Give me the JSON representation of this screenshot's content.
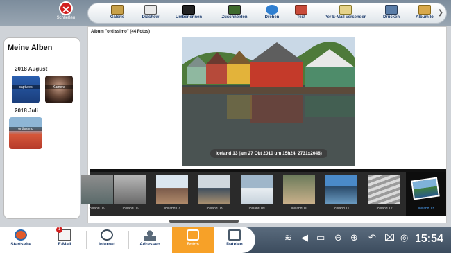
{
  "close": {
    "label": "Schließen"
  },
  "toolbar": [
    {
      "label": "Galerie",
      "icon": "gallery-icon"
    },
    {
      "label": "Diashow",
      "icon": "slideshow-icon"
    },
    {
      "label": "Umbenennen",
      "icon": "rename-icon"
    },
    {
      "label": "Zuschneiden",
      "icon": "crop-icon"
    },
    {
      "label": "Drehen",
      "icon": "rotate-icon"
    },
    {
      "label": "Text",
      "icon": "text-icon"
    },
    {
      "label": "Per E-Mail versenden",
      "icon": "email-send-icon"
    },
    {
      "label": "Drucken",
      "icon": "print-icon"
    },
    {
      "label": "Album lö",
      "icon": "album-delete-icon"
    }
  ],
  "sidebar": {
    "title": "Meine Alben",
    "groups": [
      {
        "label": "2018 August",
        "albums": [
          {
            "label": "captures"
          },
          {
            "label": "Kamera"
          }
        ]
      },
      {
        "label": "2018 Juli",
        "albums": [
          {
            "label": "ordissimo"
          }
        ]
      }
    ]
  },
  "main": {
    "album_title": "Album \"ordissimo\" (44 Fotos)",
    "photo_caption": "Iceland 13 (am 27 Okt 2010 um 15h24, 2731x2048)"
  },
  "strip": [
    {
      "label": "Iceland 05"
    },
    {
      "label": "Iceland 06"
    },
    {
      "label": "Iceland 07"
    },
    {
      "label": "Iceland 08"
    },
    {
      "label": "Iceland 09"
    },
    {
      "label": "Iceland 10"
    },
    {
      "label": "Iceland 11"
    },
    {
      "label": "Iceland 12"
    },
    {
      "label": "Iceland 13"
    }
  ],
  "dock": [
    {
      "label": "Startseite",
      "icon": "home-icon"
    },
    {
      "label": "E-Mail",
      "icon": "email-icon",
      "badge": "1"
    },
    {
      "label": "Internet",
      "icon": "globe-icon"
    },
    {
      "label": "Adressen",
      "icon": "contacts-icon"
    },
    {
      "label": "Fotos",
      "icon": "camera-icon"
    },
    {
      "label": "Dateien",
      "icon": "files-icon"
    }
  ],
  "system": {
    "clock": "15:54"
  },
  "colors": {
    "accent": "#f7a128",
    "close": "#d21f1f",
    "label_blue": "#1d3c6d",
    "selected_label": "#4fa6ff"
  }
}
